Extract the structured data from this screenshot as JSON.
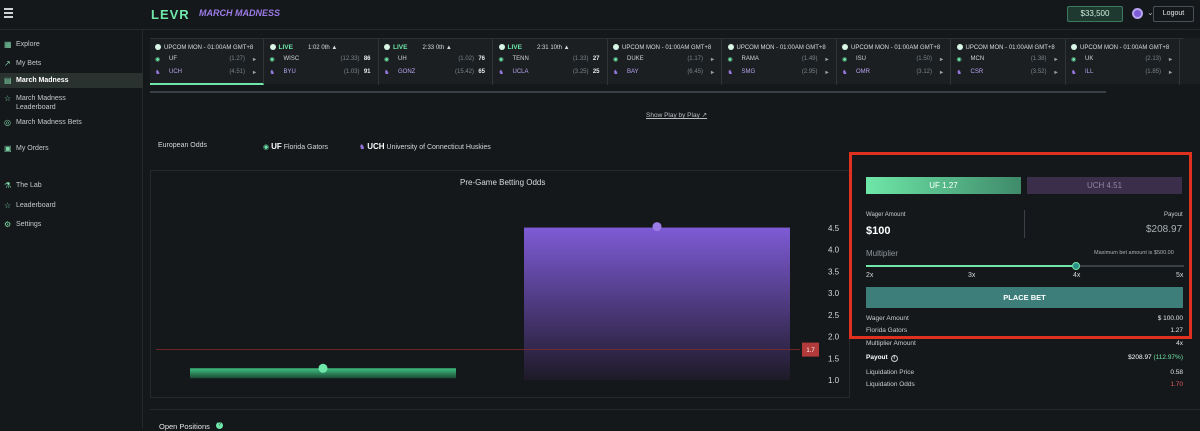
{
  "header": {
    "logo": "LEVR",
    "subtitle": "MARCH MADNESS",
    "balance": "$33,500",
    "logout": "Logout"
  },
  "sidebar": {
    "items": [
      {
        "label": "Explore",
        "icon": "explore-icon",
        "glyph": "▦"
      },
      {
        "label": "My Bets",
        "icon": "chart-icon",
        "glyph": "↗"
      },
      {
        "label": "March Madness",
        "icon": "trophy-icon",
        "glyph": "▤",
        "active": true
      },
      {
        "label": "March Madness Leaderboard",
        "icon": "trophy-icon",
        "glyph": "☆"
      },
      {
        "label": "March Madness Bets",
        "icon": "basketball-icon",
        "glyph": "◎"
      },
      {
        "label": "My Orders",
        "icon": "orders-icon",
        "glyph": "▣"
      },
      {
        "label": "The Lab",
        "icon": "flask-icon",
        "glyph": "⚗"
      },
      {
        "label": "Leaderboard",
        "icon": "trophy-icon",
        "glyph": "☆"
      },
      {
        "label": "Settings",
        "icon": "gear-icon",
        "glyph": "⚙"
      }
    ]
  },
  "ticker": [
    {
      "status": "UPCOM",
      "time": "MON - 01:00AM GMT+8",
      "a": {
        "team": "UF",
        "odds": "(1.27)",
        "score": ""
      },
      "b": {
        "team": "UCH",
        "odds": "(4.51)",
        "score": ""
      },
      "selected": true
    },
    {
      "status": "LIVE",
      "time": "1:02 0th",
      "a": {
        "team": "WISC",
        "odds": "(12.33)",
        "score": "86"
      },
      "b": {
        "team": "BYU",
        "odds": "(1.03)",
        "score": "91"
      }
    },
    {
      "status": "LIVE",
      "time": "2:33 0th",
      "a": {
        "team": "UH",
        "odds": "(1.02)",
        "score": "76"
      },
      "b": {
        "team": "GONZ",
        "odds": "(15.42)",
        "score": "65"
      }
    },
    {
      "status": "LIVE",
      "time": "2:31 10th",
      "a": {
        "team": "TENN",
        "odds": "(1.33)",
        "score": "27"
      },
      "b": {
        "team": "UCLA",
        "odds": "(3.25)",
        "score": "25"
      }
    },
    {
      "status": "UPCOM",
      "time": "MON - 01:00AM GMT+8",
      "a": {
        "team": "DUKE",
        "odds": "(1.17)",
        "score": ""
      },
      "b": {
        "team": "BAY",
        "odds": "(6.45)",
        "score": ""
      }
    },
    {
      "status": "UPCOM",
      "time": "MON - 01:00AM GMT+8",
      "a": {
        "team": "RAMA",
        "odds": "(1.49)",
        "score": ""
      },
      "b": {
        "team": "SMG",
        "odds": "(2.95)",
        "score": ""
      }
    },
    {
      "status": "UPCOM",
      "time": "MON - 01:00AM GMT+8",
      "a": {
        "team": "ISU",
        "odds": "(1.50)",
        "score": ""
      },
      "b": {
        "team": "OMR",
        "odds": "(3.12)",
        "score": ""
      }
    },
    {
      "status": "UPCOM",
      "time": "MON - 01:00AM GMT+8",
      "a": {
        "team": "MCN",
        "odds": "(1.38)",
        "score": ""
      },
      "b": {
        "team": "CSR",
        "odds": "(3.52)",
        "score": ""
      }
    },
    {
      "status": "UPCOM",
      "time": "MON - 01:00AM GMT+8",
      "a": {
        "team": "UK",
        "odds": "(2.13)",
        "score": ""
      },
      "b": {
        "team": "ILL",
        "odds": "(1.85)",
        "score": ""
      }
    }
  ],
  "play_by_play": "Show Play by Play",
  "matchup": {
    "odds_format": "European Odds",
    "team_a_abbr": "UF",
    "team_a_name": "Florida Gators",
    "team_b_abbr": "UCH",
    "team_b_name": "University of Connecticut Huskies"
  },
  "chart_data": {
    "type": "bar",
    "title": "Pre-Game Betting Odds",
    "categories": [
      "UF",
      "UCH"
    ],
    "values": [
      1.27,
      4.51
    ],
    "colors": [
      "#3fbf80",
      "#7e5bd6"
    ],
    "reference_line": {
      "value": 1.7,
      "label": "1.7",
      "color": "#e05a5a"
    },
    "yticks": [
      "1.0",
      "1.5",
      "2.0",
      "2.5",
      "3.0",
      "3.5",
      "4.0",
      "4.5"
    ],
    "ylim": [
      1.0,
      4.5
    ]
  },
  "bet": {
    "option_a": "UF 1.27",
    "option_b": "UCH 4.51",
    "wager_label": "Wager Amount",
    "wager_value": "$100",
    "payout_label": "Payout",
    "payout_value": "$208.97",
    "multiplier_label": "Multiplier",
    "max_bet": "Maximum bet amount is $500.00",
    "multiplier_marks": [
      "2x",
      "3x",
      "4x",
      "5x"
    ],
    "multiplier_value": 4,
    "place_bet": "PLACE BET",
    "summary": {
      "wager_label": "Wager Amount",
      "wager": "$ 100.00",
      "team_label": "Florida Gators",
      "team_odds": "1.27",
      "mult_label": "Multiplier Amount",
      "mult": "4x",
      "payout_label": "Payout",
      "payout": "$208.97",
      "payout_pct": "(112.97%)",
      "liq_price_label": "Liquidation Price",
      "liq_price": "0.58",
      "liq_odds_label": "Liquidation Odds",
      "liq_odds": "1.70"
    }
  },
  "open_positions": "Open Positions",
  "colors": {
    "accent": "#6ee7a8",
    "purple": "#7e5bd6",
    "highlight": "#e0301e"
  }
}
